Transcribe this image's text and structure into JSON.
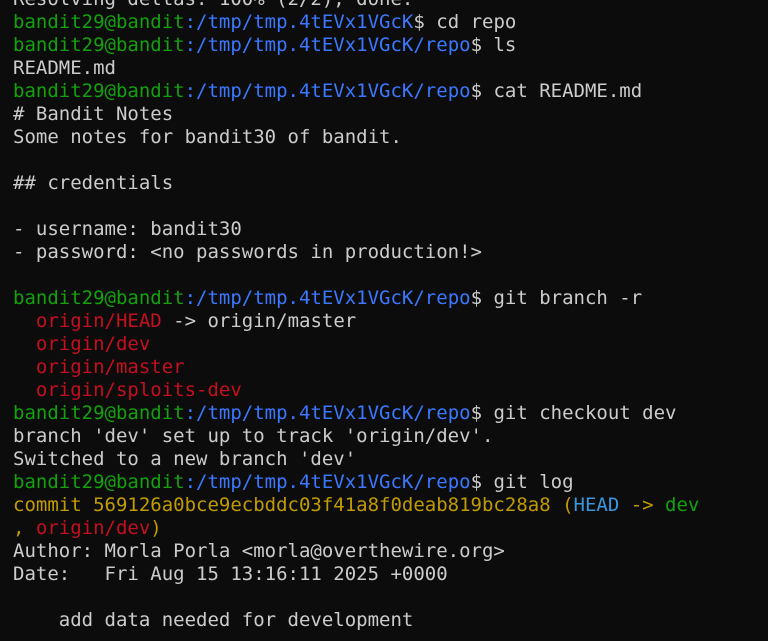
{
  "colors": {
    "background": "#0c0c0c",
    "foreground": "#cccccc",
    "prompt_user": "#13a10e",
    "prompt_path": "#3b78ff",
    "branch_red": "#c50f1f",
    "commit_yellow": "#c19c00",
    "head_cyan": "#3a96dd"
  },
  "prompt": {
    "user_host": "bandit29@bandit",
    "tmp_path": ":/tmp/tmp.4tEVx1VGcK",
    "repo_path": ":/tmp/tmp.4tEVx1VGcK/repo",
    "symbol": "$"
  },
  "lines": {
    "partial_top": "Resolving deltas: 100% (2/2), done.",
    "cmd_cd": " cd repo",
    "cmd_ls": " ls",
    "ls_output": "README.md",
    "cmd_cat": " cat README.md",
    "readme_1": "# Bandit Notes",
    "readme_2": "Some notes for bandit30 of bandit.",
    "readme_3": "",
    "readme_4": "## credentials",
    "readme_5": "",
    "readme_6": "- username: bandit30",
    "readme_7": "- password: <no passwords in production!>",
    "readme_8": "",
    "cmd_branch": " git branch -r",
    "branch_indent": "  ",
    "branch_head": "origin/HEAD",
    "branch_head_arrow": " -> origin/master",
    "branch_dev": "origin/dev",
    "branch_master": "origin/master",
    "branch_sploits": "origin/sploits-dev",
    "cmd_checkout": " git checkout dev",
    "checkout_1": "branch 'dev' set up to track 'origin/dev'.",
    "checkout_2": "Switched to a new branch 'dev'",
    "cmd_log": " git log",
    "commit_label": "commit 569126a0bce9ecbddc03f41a8f0deab819bc28a8 (",
    "commit_head": "HEAD",
    "commit_arrow": " -> ",
    "commit_dev": "dev",
    "commit_cont_comma": ", ",
    "commit_origin_dev": "origin/dev",
    "commit_close": ")",
    "author": "Author: Morla Porla <morla@overthewire.org>",
    "date": "Date:   Fri Aug 15 13:16:11 2025 +0000",
    "blank": "",
    "message": "    add data needed for development"
  }
}
